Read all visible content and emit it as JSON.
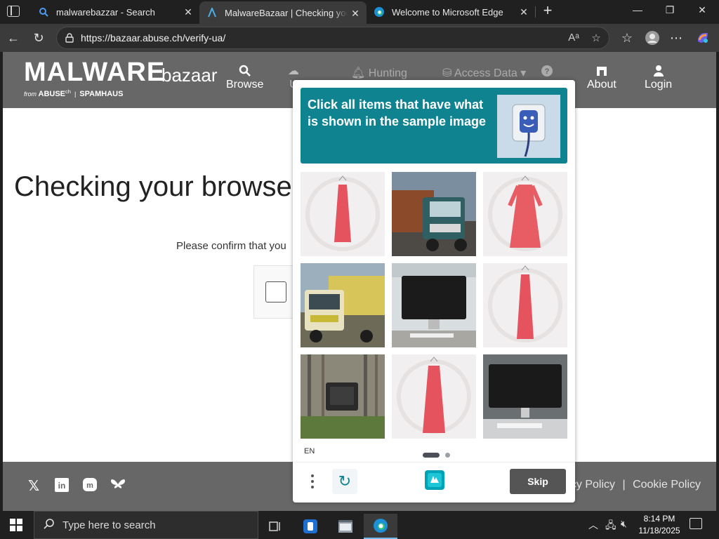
{
  "browser": {
    "tabs": [
      {
        "title": "malwarebazzar - Search",
        "icon": "search-icon"
      },
      {
        "title": "MalwareBazaar | Checking your browser",
        "icon": "abuse-logo-icon",
        "active": true
      },
      {
        "title": "Welcome to Microsoft Edge",
        "icon": "edge-icon"
      }
    ],
    "url": "https://bazaar.abuse.ch/verify-ua/",
    "read_aloud_icon": "Aᵃ"
  },
  "site": {
    "logo_main": "MALWARE",
    "logo_sub": "bazaar",
    "logo_from": "from",
    "logo_abuse": "ABUSE",
    "logo_abuse_sup": "ch",
    "logo_spamhaus": "SPAMHAUS",
    "nav": {
      "browse": "Browse",
      "upload_partial": "U",
      "hunting": "Hunting",
      "access_data": "Access Data",
      "about": "About",
      "login": "Login"
    },
    "heading": "Checking your browse",
    "confirm_text": "Please confirm that you",
    "footer_links": {
      "privacy": "acy Policy",
      "separator": "|",
      "cookie": "Cookie Policy"
    },
    "social": [
      "x-icon",
      "linkedin-icon",
      "mastodon-icon",
      "bluesky-icon"
    ]
  },
  "captcha": {
    "prompt": "Click all items that have what is shown in the sample image",
    "sample": "power-outlet-with-plug",
    "grid": [
      "red-dress",
      "truck-teal",
      "red-dress",
      "truck-yellow",
      "computer-monitor",
      "red-dress",
      "crt-tv-in-forest",
      "red-dress",
      "computer-monitor"
    ],
    "language": "EN",
    "skip_label": "Skip",
    "page": 1,
    "pages": 2
  },
  "taskbar": {
    "search_placeholder": "Type here to search",
    "time": "8:14 PM",
    "date": "11/18/2025"
  },
  "colors": {
    "captcha_teal": "#0f8390",
    "site_header": "#676767",
    "skip_button": "#555555"
  }
}
